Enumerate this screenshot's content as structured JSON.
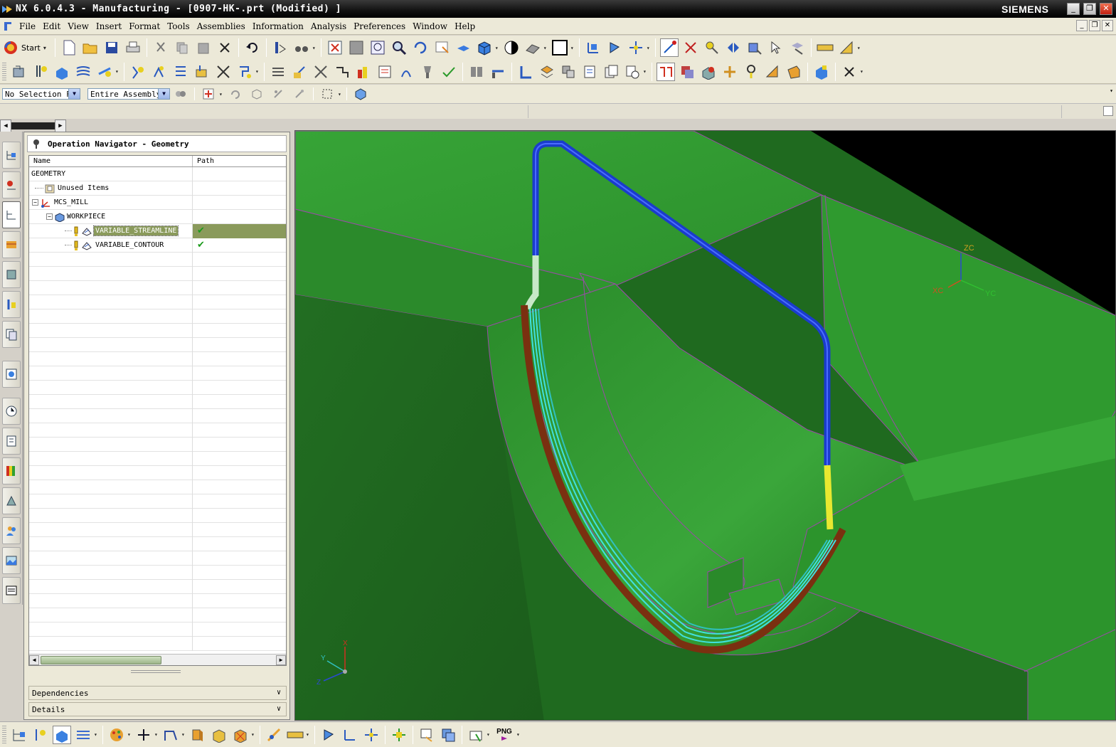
{
  "window": {
    "title": "NX 6.0.4.3 - Manufacturing - [0907-HK-.prt (Modified) ]",
    "brand": "SIEMENS"
  },
  "menu": {
    "items": [
      "File",
      "Edit",
      "View",
      "Insert",
      "Format",
      "Tools",
      "Assemblies",
      "Information",
      "Analysis",
      "Preferences",
      "Window",
      "Help"
    ]
  },
  "toolbar": {
    "start_label": "Start"
  },
  "selection": {
    "filter_value": "No Selection Fi",
    "scope_value": "Entire Assembly"
  },
  "navigator": {
    "title": "Operation Navigator - Geometry",
    "col_name": "Name",
    "col_path": "Path",
    "rows": [
      {
        "name": "GEOMETRY"
      },
      {
        "name": "Unused Items"
      },
      {
        "name": "MCS_MILL"
      },
      {
        "name": "WORKPIECE"
      },
      {
        "name": "VARIABLE_STREAMLINE",
        "path": "✔"
      },
      {
        "name": "VARIABLE_CONTOUR",
        "path": "✔"
      }
    ],
    "dependencies_label": "Dependencies",
    "details_label": "Details"
  },
  "viewport": {
    "wcs_labels": {
      "zc": "ZC",
      "xc": "XC",
      "yc": "YC"
    },
    "triad_labels": {
      "x": "X",
      "y": "Y",
      "z": "Z"
    },
    "colors": {
      "background": "#000000",
      "part_green": "#2f9a2f",
      "toolpath_blue": "#1a3ccc",
      "toolpath_cyan": "#40e0e0",
      "toolpath_yellow": "#e8e830",
      "edge_magenta": "#9a4aa8"
    }
  },
  "bottom_toolbar": {
    "png_label": "PNG"
  }
}
